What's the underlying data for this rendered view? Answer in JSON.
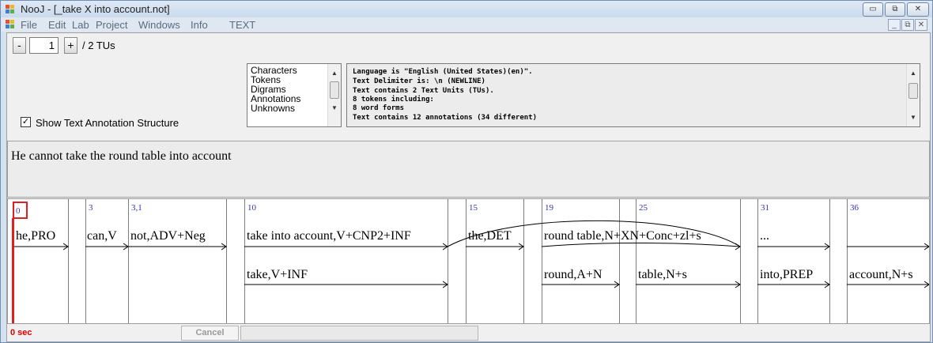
{
  "window": {
    "title": "NooJ - [_take X into account.not]"
  },
  "menu": [
    "File",
    "Edit",
    "Lab",
    "Project",
    "Windows",
    "Info",
    "TEXT"
  ],
  "window_controls": {
    "minimize": "▭",
    "restore": "⧉",
    "close": "✕"
  },
  "mdi_controls": {
    "minimize": "_",
    "restore": "⧉",
    "close": "✕"
  },
  "nav": {
    "prev": "-",
    "current": "1",
    "next": "+",
    "total_label": "/ 2 TUs"
  },
  "show_tas": {
    "checked": "✓",
    "label": "Show Text Annotation Structure"
  },
  "listbox": [
    "Characters",
    "Tokens",
    "Digrams",
    "Annotations",
    "Unknowns"
  ],
  "info_lines": [
    "Language is \"English (United States)(en)\".",
    "Text Delimiter is: \\n (NEWLINE)",
    "Text contains 2 Text Units (TUs).",
    "8 tokens including:",
    "8 word forms",
    "Text contains 12 annotations (34 different)"
  ],
  "sentence": "He cannot take the round table into account",
  "positions": [
    "0",
    "3",
    "3,1",
    "10",
    "15",
    "19",
    "25",
    "31",
    "36"
  ],
  "annotations_row1": [
    "he,PRO",
    "can,V",
    "not,ADV+Neg",
    "take into account,V+CNP2+INF",
    "the,DET",
    "round table,N+XN+Conc+zl+s",
    "..."
  ],
  "annotations_row2": [
    "take,V+INF",
    "round,A+N",
    "table,N+s",
    "into,PREP",
    "account,N+s"
  ],
  "status": {
    "time": "0 sec",
    "cancel": "Cancel"
  },
  "colors": {
    "cursor": "#e02020",
    "position_number": "#3030c0",
    "status_time": "#e00000"
  }
}
